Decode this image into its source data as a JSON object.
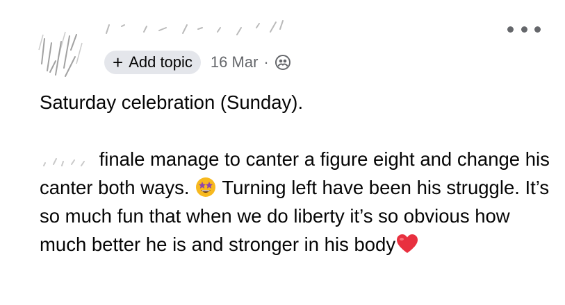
{
  "post": {
    "add_topic_label": "Add topic",
    "date": "16 Mar",
    "separator": "·",
    "title_line": "Saturday celebration (Sunday).",
    "paragraph_seg1": "finale manage to canter a figure eight and change his canter both ways.",
    "paragraph_seg2": "Turning left have been his struggle. It’s so much fun that when we do liberty it’s so obvious how much better he is and stronger in his body"
  },
  "icons": {
    "more": "more-options-icon",
    "audience": "audience-friends-icon",
    "star_struck": "star-struck-emoji",
    "heart": "red-heart-emoji"
  },
  "colors": {
    "text": "#050505",
    "secondary": "#65676b",
    "chip_bg": "#e4e6eb",
    "heart": "#e8303f",
    "star_face": "#f7b91f",
    "star_eyes": "#8e44ad"
  }
}
